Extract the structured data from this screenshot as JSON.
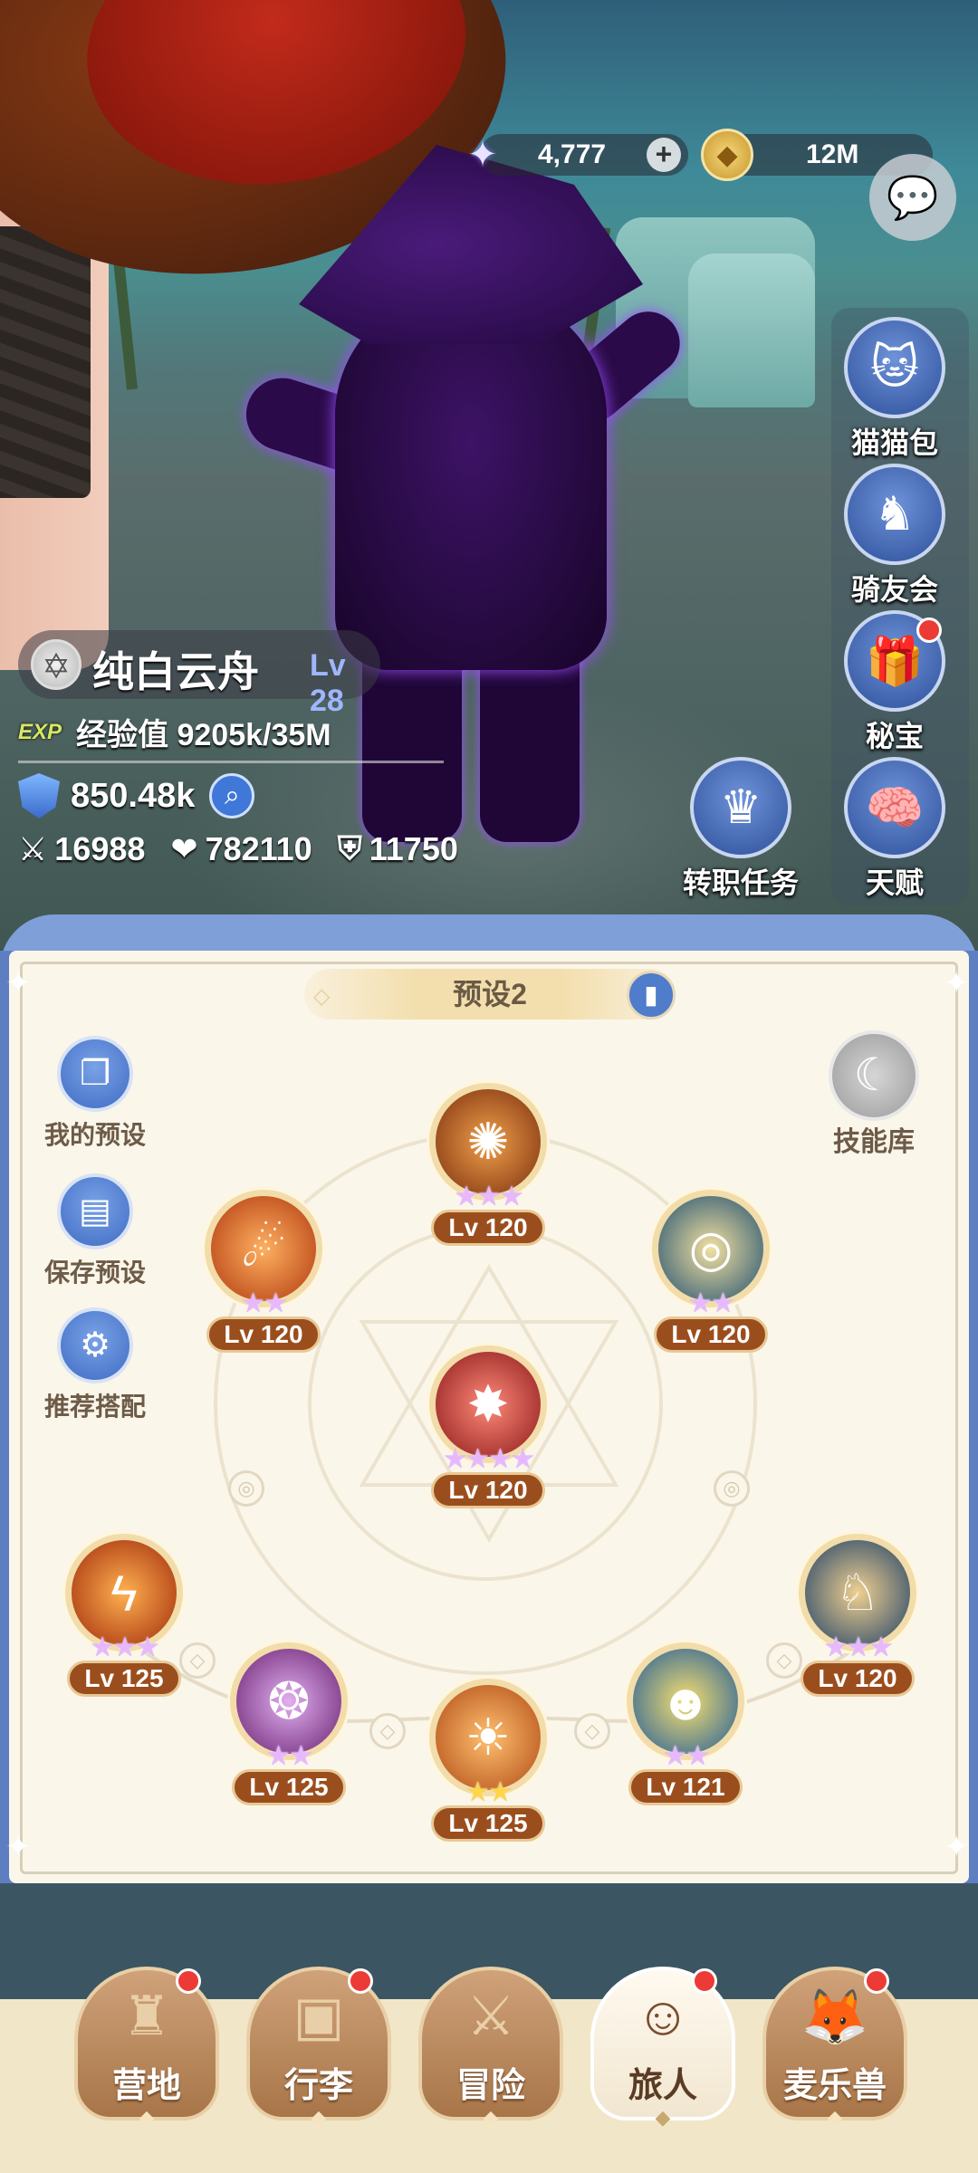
{
  "currency": {
    "gems": "4,777",
    "gold": "12M",
    "gems_icon": "star-gem-icon",
    "gold_icon": "gold-coin-icon"
  },
  "side_menu": [
    {
      "label": "猫猫包",
      "icon": "cat-bag-icon",
      "badge": false
    },
    {
      "label": "骑友会",
      "icon": "horse-head-icon",
      "badge": false
    },
    {
      "label": "秘宝",
      "icon": "treasure-chest-icon",
      "badge": true
    },
    {
      "label": "天赋",
      "icon": "brain-head-icon",
      "badge": false
    }
  ],
  "job_quest": {
    "label": "转职任务",
    "icon": "crown-icon"
  },
  "player": {
    "name": "纯白云舟",
    "level": "Lv 28",
    "exp_tag": "EXP",
    "exp_text": "经验值 9205k/35M",
    "power": "850.48k",
    "attack": "16988",
    "hp": "782110",
    "defense": "11750"
  },
  "preset": {
    "title": "预设2",
    "tools": [
      {
        "label": "我的预设",
        "icon": "cards-icon"
      },
      {
        "label": "保存预设",
        "icon": "save-disk-icon"
      },
      {
        "label": "推荐搭配",
        "icon": "recommend-icon"
      }
    ],
    "skill_library": "技能库"
  },
  "skills": [
    {
      "lv": "Lv 120",
      "stars": "★★★",
      "star_color": "purple",
      "color": "#c4682a"
    },
    {
      "lv": "Lv 120",
      "stars": "★★",
      "star_color": "purple",
      "color": "#d8502a"
    },
    {
      "lv": "Lv 120",
      "stars": "★★",
      "star_color": "purple",
      "color": "#2f6f9a"
    },
    {
      "lv": "Lv 120",
      "stars": "★★★★",
      "star_color": "purple",
      "color": "#b03030"
    },
    {
      "lv": "Lv 125",
      "stars": "★★★",
      "star_color": "purple",
      "color": "#c85a22"
    },
    {
      "lv": "Lv 125",
      "stars": "★★",
      "star_color": "purple",
      "color": "#8a3a8a"
    },
    {
      "lv": "Lv 125",
      "stars": "★★",
      "star_color": "gold",
      "color": "#c4602a"
    },
    {
      "lv": "Lv 121",
      "stars": "★★",
      "star_color": "purple",
      "color": "#2a6ab0"
    },
    {
      "lv": "Lv 120",
      "stars": "★★★",
      "star_color": "purple",
      "color": "#2d5a8a"
    }
  ],
  "bottom_nav": [
    {
      "label": "营地",
      "icon": "castle-icon",
      "badge": true,
      "active": false
    },
    {
      "label": "行李",
      "icon": "backpack-icon",
      "badge": true,
      "active": false
    },
    {
      "label": "冒险",
      "icon": "crossed-swords-icon",
      "badge": false,
      "active": false
    },
    {
      "label": "旅人",
      "icon": "traveler-avatar-icon",
      "badge": true,
      "active": true
    },
    {
      "label": "麦乐兽",
      "icon": "fox-pet-icon",
      "badge": true,
      "active": false
    }
  ]
}
